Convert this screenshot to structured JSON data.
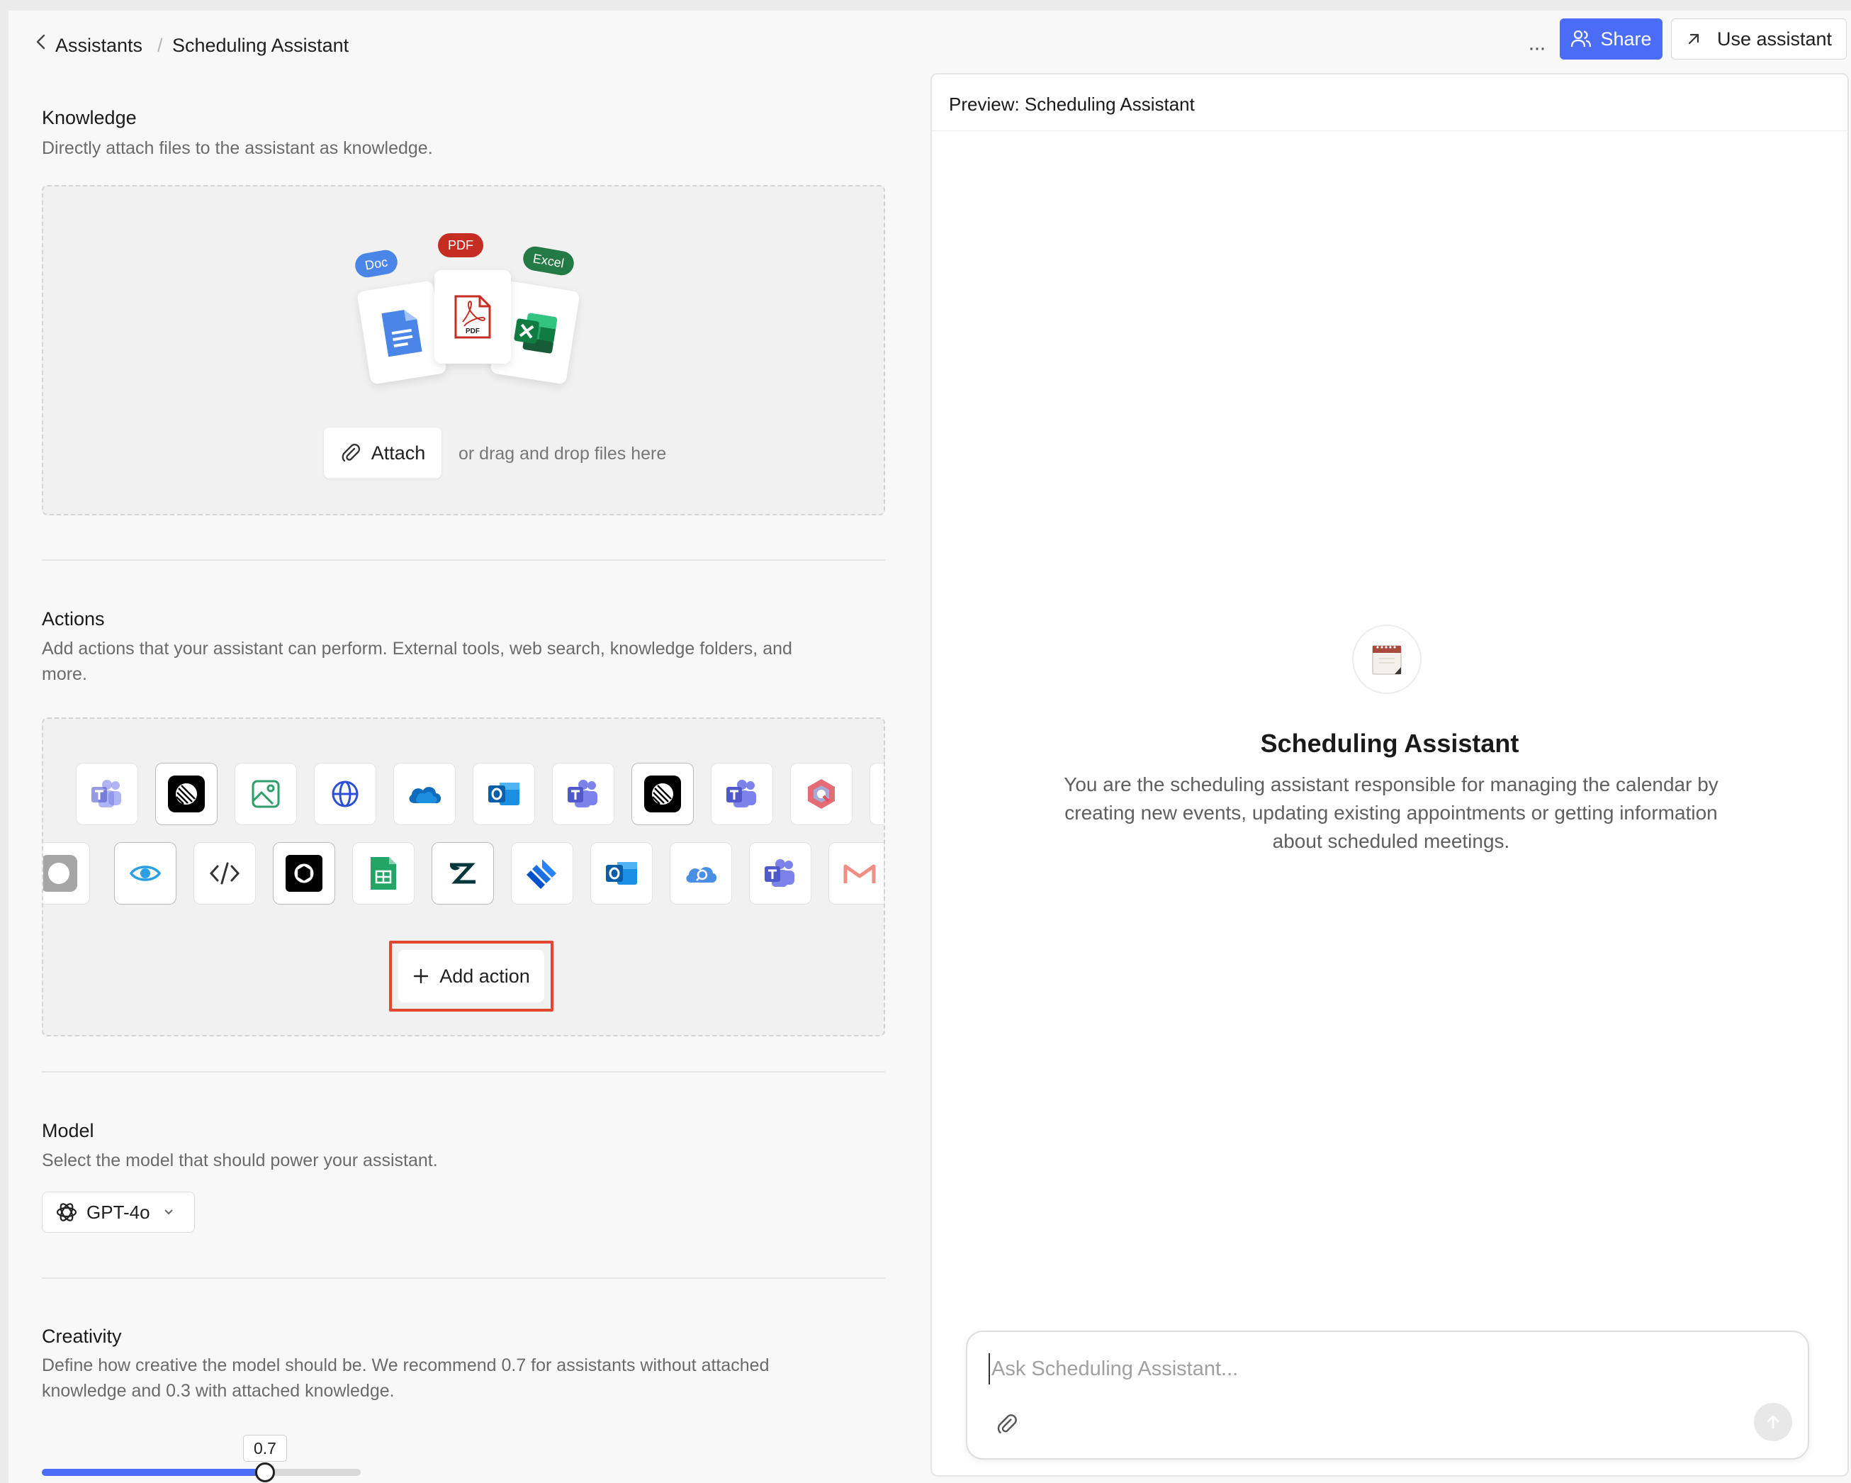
{
  "header": {
    "breadcrumb_parent": "Assistants",
    "breadcrumb_separator": "/",
    "breadcrumb_current": "Scheduling Assistant",
    "more_label": "···",
    "share_label": "Share",
    "use_label": "Use assistant"
  },
  "knowledge": {
    "title": "Knowledge",
    "description": "Directly attach files to the assistant as knowledge.",
    "file_tags": [
      "Doc",
      "PDF",
      "Excel"
    ],
    "pdf_icon_text": "PDF",
    "attach_label": "Attach",
    "drag_hint": "or drag and drop files here"
  },
  "actions": {
    "title": "Actions",
    "description_line1": "Add actions that your assistant can perform. External tools, web search, knowledge folders, and",
    "description_line2": "more.",
    "row1_icons": [
      "microsoft-teams-icon",
      "linear-icon",
      "image-generation-icon",
      "web-search-icon",
      "onedrive-icon",
      "outlook-icon",
      "microsoft-teams-icon",
      "linear-icon",
      "microsoft-teams-icon",
      "q-logo-icon"
    ],
    "row2_icons": [
      "linear-icon",
      "eye-icon",
      "code-icon",
      "openai-icon",
      "google-sheets-icon",
      "zendesk-icon",
      "jira-icon",
      "outlook-icon",
      "cloud-search-icon",
      "microsoft-teams-icon",
      "gmail-icon"
    ],
    "add_action_label": "Add action"
  },
  "model": {
    "title": "Model",
    "description": "Select the model that should power your assistant.",
    "selected": "GPT-4o"
  },
  "creativity": {
    "title": "Creativity",
    "description_line1": "Define how creative the model should be. We recommend 0.7 for assistants without attached",
    "description_line2": "knowledge and 0.3 with attached knowledge.",
    "value_label": "0.7",
    "value": 0.7,
    "min": 0,
    "max": 1
  },
  "preview": {
    "title": "Preview: Scheduling Assistant",
    "assistant_name": "Scheduling Assistant",
    "assistant_description": "You are the scheduling assistant responsible for managing the calendar by creating new events, updating existing appointments or getting information about scheduled meetings.",
    "input_placeholder": "Ask Scheduling Assistant..."
  },
  "colors": {
    "accent": "#4a6cf7",
    "highlight_border": "#e2472f",
    "doc_tag": "#4a86e8",
    "pdf_tag": "#c62d22",
    "excel_tag": "#237a45"
  }
}
